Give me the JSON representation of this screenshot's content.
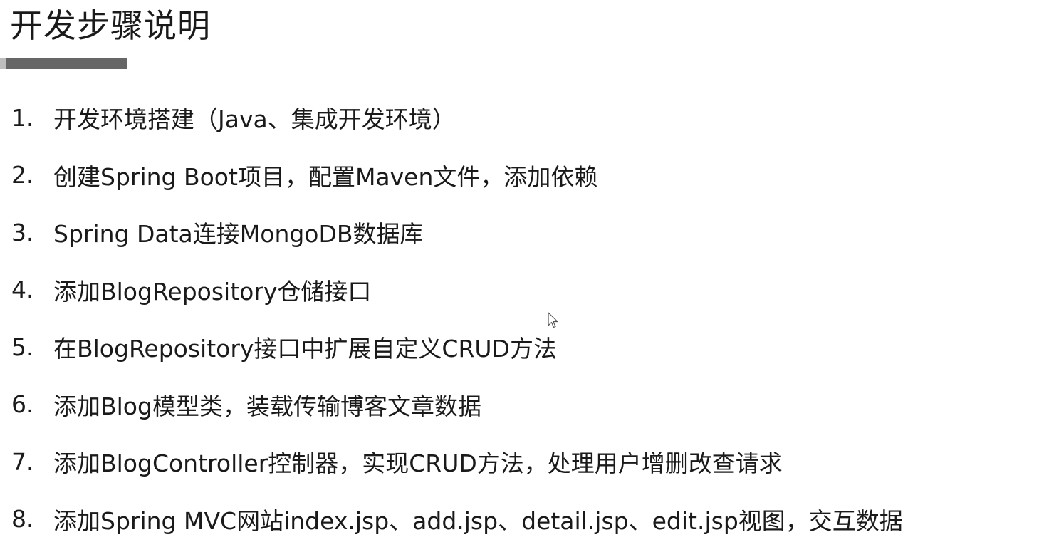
{
  "title": "开发步骤说明",
  "steps": [
    {
      "number": "1.",
      "text": "开发环境搭建（Java、集成开发环境）"
    },
    {
      "number": "2.",
      "text": "创建Spring Boot项目，配置Maven文件，添加依赖"
    },
    {
      "number": "3.",
      "text": "Spring Data连接MongoDB数据库"
    },
    {
      "number": "4.",
      "text": "添加BlogRepository仓储接口"
    },
    {
      "number": "5.",
      "text": "在BlogRepository接口中扩展自定义CRUD方法"
    },
    {
      "number": "6.",
      "text": "添加Blog模型类，装载传输博客文章数据"
    },
    {
      "number": "7.",
      "text": "添加BlogController控制器，实现CRUD方法，处理用户增删改查请求"
    },
    {
      "number": "8.",
      "text": "添加Spring MVC网站index.jsp、add.jsp、detail.jsp、edit.jsp视图，交互数据"
    }
  ],
  "colors": {
    "text": "#1a1a1a",
    "underline": "#666666",
    "underline_cap": "#bdbdbd",
    "background": "#ffffff"
  },
  "icons": {
    "cursor": "mouse-pointer-icon"
  }
}
